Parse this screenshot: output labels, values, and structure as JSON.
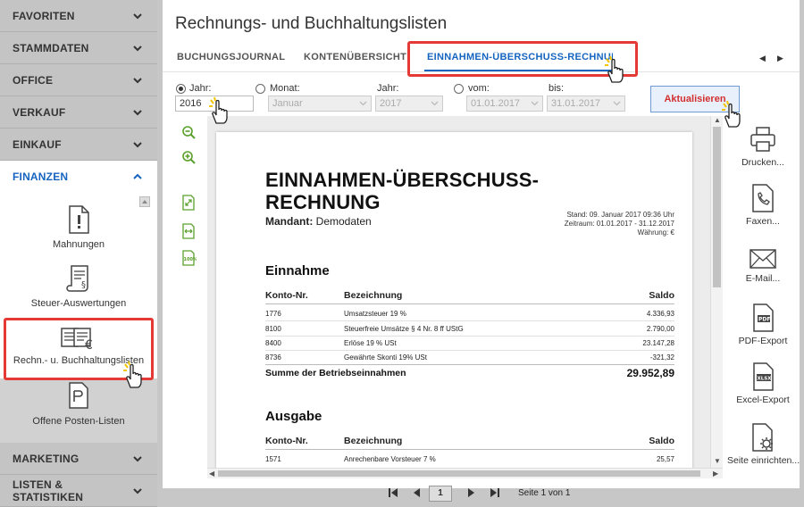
{
  "sidebar": {
    "top_items": [
      {
        "label": "FAVORITEN"
      },
      {
        "label": "STAMMDATEN"
      },
      {
        "label": "OFFICE"
      },
      {
        "label": "VERKAUF"
      },
      {
        "label": "EINKAUF"
      }
    ],
    "active": {
      "label": "FINANZEN"
    },
    "sub_items": [
      {
        "label": "Mahnungen",
        "icon": "reminder-document-icon"
      },
      {
        "label": "Steuer-Auswertungen",
        "icon": "tax-scroll-icon"
      },
      {
        "label": "Rechn.- u. Buchhaltungslisten",
        "icon": "invoice-euro-icon"
      },
      {
        "label": "Offene Posten-Listen",
        "icon": "open-items-document-icon"
      }
    ],
    "bottom_items": [
      {
        "label": "MARKETING"
      },
      {
        "label": "LISTEN & STATISTIKEN"
      }
    ]
  },
  "main": {
    "title": "Rechnungs- und Buchhaltungslisten",
    "tabs": [
      {
        "label": "BUCHUNGSJOURNAL"
      },
      {
        "label": "KONTENÜBERSICHT"
      },
      {
        "label": "EINNAHMEN-ÜBERSCHUSS-RECHNUNG"
      }
    ],
    "filters": {
      "jahr_label": "Jahr:",
      "jahr_value": "2016",
      "monat_label": "Monat:",
      "monat_value": "Januar",
      "monat_jahr_label": "Jahr:",
      "monat_jahr_value": "2017",
      "vom_label": "vom:",
      "vom_value": "01.01.2017",
      "bis_label": "bis:",
      "bis_value": "31.01.2017",
      "refresh_label": "Aktualisieren"
    }
  },
  "document": {
    "title_line1": "EINNAHMEN-ÜBERSCHUSS-",
    "title_line2": "RECHNUNG",
    "mandant_label": "Mandant:",
    "mandant_value": "Demodaten",
    "stand": "Stand: 09. Januar 2017 09:36 Uhr",
    "zeitraum": "Zeitraum: 01.01.2017 - 31.12.2017",
    "waehrung": "Währung: €",
    "col_konto": "Konto-Nr.",
    "col_bez": "Bezeichnung",
    "col_saldo": "Saldo",
    "einnahme": {
      "title": "Einnahme",
      "rows": [
        {
          "konto": "1776",
          "bez": "Umsatzsteuer 19 %",
          "saldo": "4.336,93"
        },
        {
          "konto": "8100",
          "bez": "Steuerfreie Umsätze § 4 Nr. 8 ff UStG",
          "saldo": "2.790,00"
        },
        {
          "konto": "8400",
          "bez": "Erlöse 19 % USt",
          "saldo": "23.147,28"
        },
        {
          "konto": "8736",
          "bez": "Gewährte Skonti 19% USt",
          "saldo": "-321,32"
        }
      ],
      "sum_label": "Summe der Betriebseinnahmen",
      "sum_value": "29.952,89"
    },
    "ausgabe": {
      "title": "Ausgabe",
      "rows": [
        {
          "konto": "1571",
          "bez": "Anrechenbare Vorsteuer 7 %",
          "saldo": "25,57"
        }
      ]
    }
  },
  "actions": [
    {
      "label": "Drucken...",
      "icon": "printer-icon"
    },
    {
      "label": "Faxen...",
      "icon": "fax-icon"
    },
    {
      "label": "E-Mail...",
      "icon": "email-icon"
    },
    {
      "label": "PDF-Export",
      "icon": "pdf-file-icon"
    },
    {
      "label": "Excel-Export",
      "icon": "xlsx-file-icon"
    },
    {
      "label": "Seite einrichten...",
      "icon": "page-setup-icon"
    }
  ],
  "pager": {
    "page": "1",
    "info": "Seite 1 von 1"
  },
  "colors": {
    "accent": "#1565c0",
    "highlight": "#e53935",
    "refresh_text": "#d32f2f",
    "icon_green": "#5aa02c"
  }
}
